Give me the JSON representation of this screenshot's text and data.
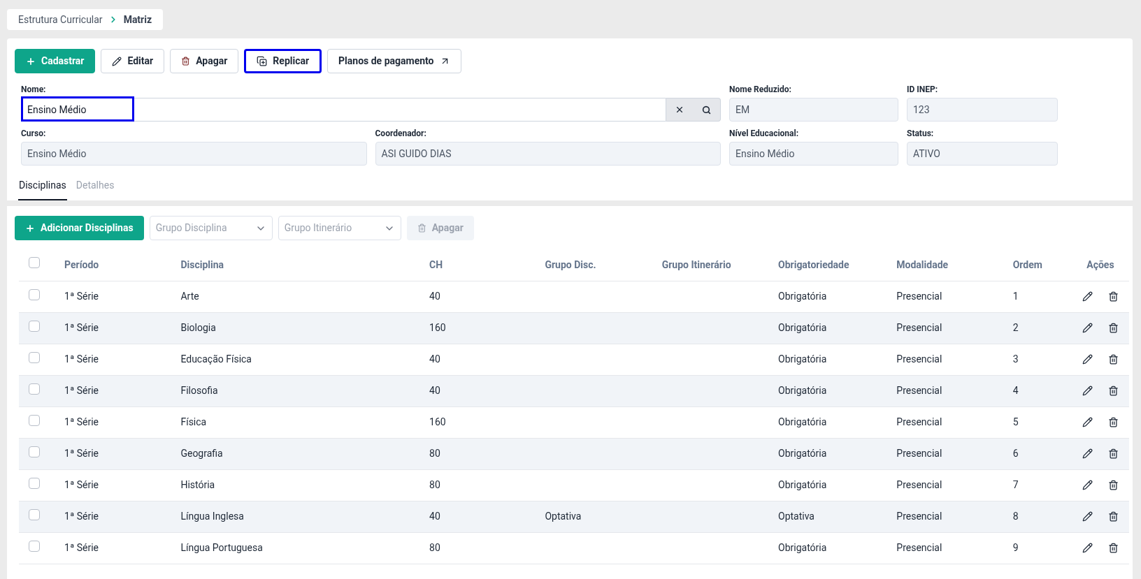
{
  "breadcrumb": [
    {
      "label": "Estrutura Curricular",
      "current": false
    },
    {
      "label": "Matriz",
      "current": true
    }
  ],
  "toolbar": [
    {
      "label": "Cadastrar",
      "kind": "add",
      "highlighted": false
    },
    {
      "label": "Editar",
      "kind": "edit",
      "highlighted": false
    },
    {
      "label": "Apagar",
      "kind": "delete",
      "highlighted": false
    },
    {
      "label": "Replicar",
      "kind": "replicate",
      "highlighted": true
    },
    {
      "label": "Planos de pagamento",
      "kind": "link",
      "highlighted": false
    }
  ],
  "fields": [
    {
      "label": "Nome:",
      "value": "Ensino Médio",
      "kind": "search",
      "highlighted": true
    },
    {
      "label": "Nome Reduzido:",
      "value": "EM",
      "kind": "readonly"
    },
    {
      "label": "ID INEP:",
      "value": "123",
      "kind": "readonly"
    },
    {
      "label": "Curso:",
      "value": "Ensino Médio",
      "kind": "readonly"
    },
    {
      "label": "Coordenador:",
      "value": "ASI GUIDO DIAS",
      "kind": "readonly"
    },
    {
      "label": "Nível Educacional:",
      "value": "Ensino Médio",
      "kind": "readonly"
    },
    {
      "label": "Status:",
      "value": "ATIVO",
      "kind": "readonly"
    }
  ],
  "tabs": [
    {
      "label": "Disciplinas",
      "selected": true
    },
    {
      "label": "Detalhes",
      "selected": false
    }
  ],
  "table_toolbar": {
    "add_button": "Adicionar Disciplinas",
    "filters": [
      {
        "placeholder": "Grupo Disciplina"
      },
      {
        "placeholder": "Grupo Itinerário"
      }
    ],
    "delete_button": {
      "label": "Apagar",
      "disabled": true
    }
  },
  "table": {
    "all_checked": false,
    "columns": [
      "Período",
      "Disciplina",
      "CH",
      "Grupo Disc.",
      "Grupo Itinerário",
      "Obrigatoriedade",
      "Modalidade",
      "Ordem",
      "Ações"
    ],
    "rows": [
      {
        "checked": false,
        "cells": [
          "1ª Série",
          "Arte",
          "40",
          "",
          "",
          "Obrigatória",
          "Presencial",
          "1"
        ]
      },
      {
        "checked": false,
        "cells": [
          "1ª Série",
          "Biologia",
          "160",
          "",
          "",
          "Obrigatória",
          "Presencial",
          "2"
        ]
      },
      {
        "checked": false,
        "cells": [
          "1ª Série",
          "Educação Física",
          "40",
          "",
          "",
          "Obrigatória",
          "Presencial",
          "3"
        ]
      },
      {
        "checked": false,
        "cells": [
          "1ª Série",
          "Filosofia",
          "40",
          "",
          "",
          "Obrigatória",
          "Presencial",
          "4"
        ]
      },
      {
        "checked": false,
        "cells": [
          "1ª Série",
          "Física",
          "160",
          "",
          "",
          "Obrigatória",
          "Presencial",
          "5"
        ]
      },
      {
        "checked": false,
        "cells": [
          "1ª Série",
          "Geografia",
          "80",
          "",
          "",
          "Obrigatória",
          "Presencial",
          "6"
        ]
      },
      {
        "checked": false,
        "cells": [
          "1ª Série",
          "História",
          "80",
          "",
          "",
          "Obrigatória",
          "Presencial",
          "7"
        ]
      },
      {
        "checked": false,
        "cells": [
          "1ª Série",
          "Língua Inglesa",
          "40",
          "Optativa",
          "",
          "Optativa",
          "Presencial",
          "8"
        ]
      },
      {
        "checked": false,
        "cells": [
          "1ª Série",
          "Língua Portuguesa",
          "80",
          "",
          "",
          "Obrigatória",
          "Presencial",
          "9"
        ]
      }
    ]
  }
}
